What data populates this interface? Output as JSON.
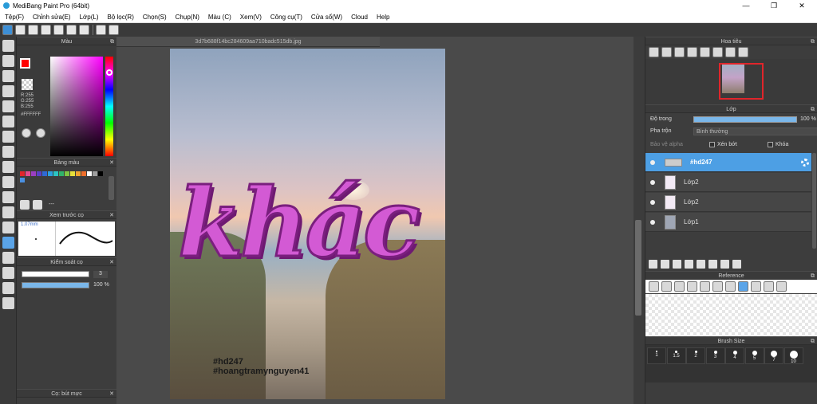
{
  "window": {
    "title": "MediBang Paint Pro (64bit)",
    "minimize": "—",
    "maximize": "❐",
    "close": "✕"
  },
  "menu": [
    "Tệp(F)",
    "Chỉnh sửa(E)",
    "Lớp(L)",
    "Bộ lọc(R)",
    "Chọn(S)",
    "Chụp(N)",
    "Màu (C)",
    "Xem(V)",
    "Công cụ(T)",
    "Cửa sổ(W)",
    "Cloud",
    "Help"
  ],
  "panels": {
    "color": {
      "title": "Màu",
      "rgb": "R:255\nG:255\nB:255",
      "hex": "#FFFFFF"
    },
    "palette": {
      "title": "Bảng màu",
      "colors": [
        "#e0252b",
        "#e34b8f",
        "#9b3ec2",
        "#5a3fc7",
        "#2f6ad6",
        "#2ba0e0",
        "#2bc4c4",
        "#30b36b",
        "#7fc442",
        "#e6e03a",
        "#f0a430",
        "#f06f2b",
        "#ffffff",
        "#9e9e9e",
        "#000000",
        "#4a90e2"
      ],
      "more": "---"
    },
    "brush_preview": {
      "title": "Xem trước cọ",
      "size": "1.07mm"
    },
    "brush_control": {
      "title": "Kiểm soát cọ",
      "size_value": "3",
      "opacity_value": "100 %"
    },
    "brush_panel": {
      "title": "Cọ: bút mực"
    },
    "navigator": {
      "title": "Hoa tiêu"
    },
    "layer": {
      "title": "Lớp",
      "opacity_label": "Độ trong",
      "opacity_value": "100 %",
      "blend_label": "Pha trộn",
      "blend_value": "Bình thường",
      "protect_alpha": "Bảo vệ alpha",
      "clipping": "Xén bớt",
      "lock": "Khóa",
      "layers": [
        {
          "name": "#hd247",
          "active": true
        },
        {
          "name": "Lớp2",
          "active": false
        },
        {
          "name": "Lớp2",
          "active": false
        },
        {
          "name": "Lớp1",
          "active": false
        }
      ]
    },
    "reference": {
      "title": "Reference"
    },
    "brush_size": {
      "title": "Brush Size",
      "sizes": [
        "1",
        "1.5",
        "2",
        "3",
        "4",
        "5",
        "7",
        "10"
      ]
    }
  },
  "document": {
    "tab": "3d7b688f14bc284609aa710badc515db.jpg",
    "art_text": "khác",
    "hashtag1": "#hd247",
    "hashtag2": "#hoangtramynguyen41"
  }
}
